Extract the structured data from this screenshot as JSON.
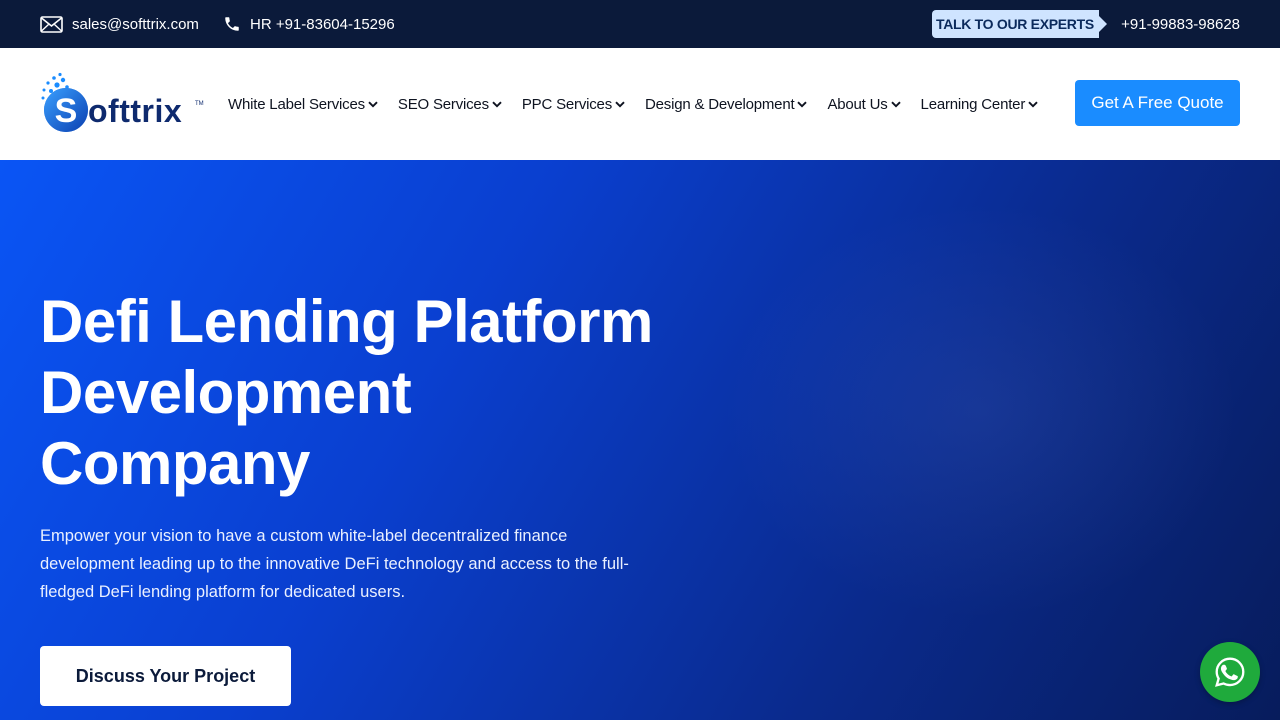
{
  "topbar": {
    "email": "sales@softtrix.com",
    "hr_phone": "HR +91-83604-15296",
    "talk_label": "TALK TO OUR EXPERTS",
    "main_phone": "+91-99883-98628"
  },
  "header": {
    "logo_text": "Softtrix",
    "nav": [
      {
        "label": "White Label Services"
      },
      {
        "label": "SEO Services"
      },
      {
        "label": "PPC Services"
      },
      {
        "label": "Design & Development"
      },
      {
        "label": "About Us"
      },
      {
        "label": "Learning Center"
      }
    ],
    "quote_button": "Get A Free Quote"
  },
  "hero": {
    "title_line1": "Defi Lending Platform",
    "title_line2": "Development",
    "title_line3": "Company",
    "description": "Empower your vision to have a custom white-label decentralized finance development leading up to the innovative DeFi technology and access to the full-fledged DeFi lending platform for dedicated users.",
    "cta": "Discuss Your Project"
  },
  "colors": {
    "topbar_bg": "#0b1a3a",
    "accent_blue": "#1a8cff",
    "hero_start": "#0a55f5",
    "hero_end": "#071c5c",
    "whatsapp_green": "#1faa3c"
  },
  "icons": [
    "mail-icon",
    "phone-icon",
    "chevron-down-icon",
    "whatsapp-icon"
  ]
}
